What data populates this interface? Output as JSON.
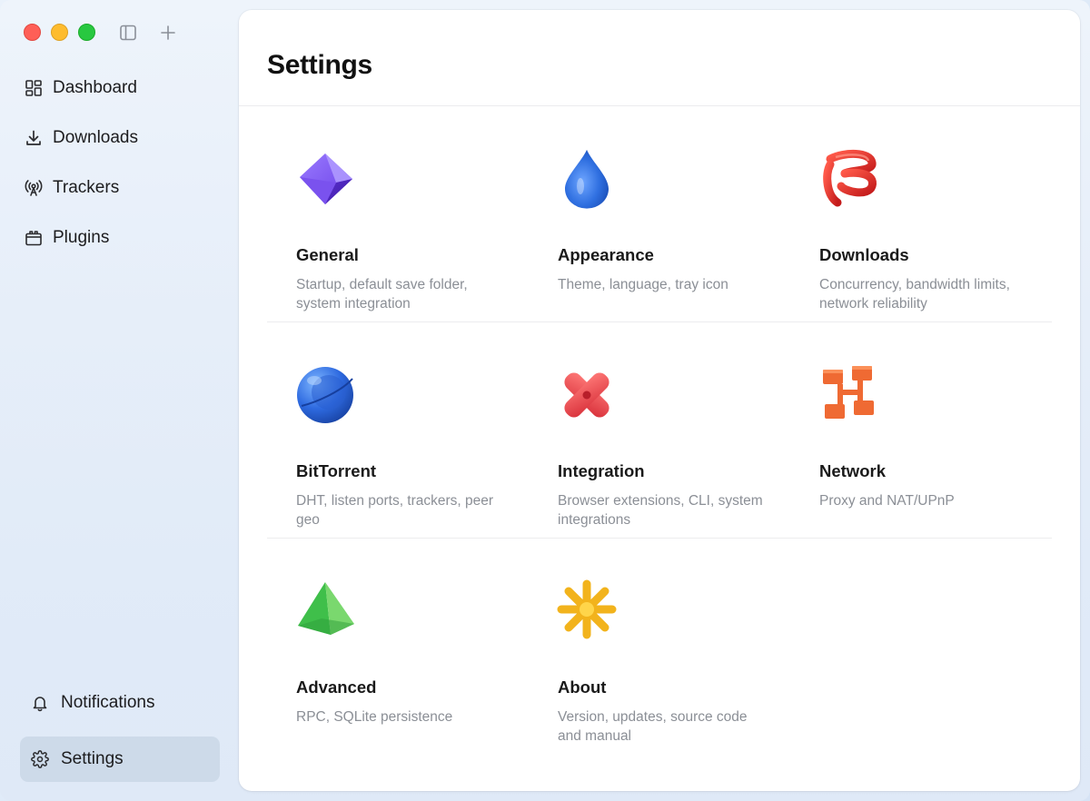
{
  "window": {
    "traffic_lights": [
      "close",
      "minimize",
      "maximize"
    ],
    "toolbar_icons": [
      "sidebar-toggle-icon",
      "plus-icon"
    ]
  },
  "sidebar": {
    "items": [
      {
        "label": "Dashboard",
        "icon": "dashboard-grid-icon"
      },
      {
        "label": "Downloads",
        "icon": "download-icon"
      },
      {
        "label": "Trackers",
        "icon": "antenna-icon"
      },
      {
        "label": "Plugins",
        "icon": "plugin-box-icon"
      }
    ],
    "bottom_items": [
      {
        "label": "Notifications",
        "icon": "bell-icon"
      },
      {
        "label": "Settings",
        "icon": "gear-icon",
        "active": true
      }
    ]
  },
  "main": {
    "title": "Settings",
    "sections": [
      {
        "title": "General",
        "desc": "Startup, default save folder, system integration",
        "icon": "purple-octahedron-icon"
      },
      {
        "title": "Appearance",
        "desc": "Theme, language, tray icon",
        "icon": "blue-drop-icon"
      },
      {
        "title": "Downloads",
        "desc": "Concurrency, bandwidth limits, network reliability",
        "icon": "red-spiral-icon"
      },
      {
        "title": "BitTorrent",
        "desc": "DHT, listen ports, trackers, peer geo",
        "icon": "blue-sphere-icon"
      },
      {
        "title": "Integration",
        "desc": "Browser extensions, CLI, system integrations",
        "icon": "red-cross-icon"
      },
      {
        "title": "Network",
        "desc": "Proxy and NAT/UPnP",
        "icon": "orange-network-icon"
      },
      {
        "title": "Advanced",
        "desc": "RPC, SQLite persistence",
        "icon": "green-pyramid-icon"
      },
      {
        "title": "About",
        "desc": "Version, updates, source code and manual",
        "icon": "yellow-star-icon"
      }
    ]
  },
  "colors": {
    "close": "#fe5f57",
    "minimize": "#febc2e",
    "maximize": "#28c840",
    "muted_text": "#8b8f96",
    "active_nav": "#c8d5e4"
  }
}
